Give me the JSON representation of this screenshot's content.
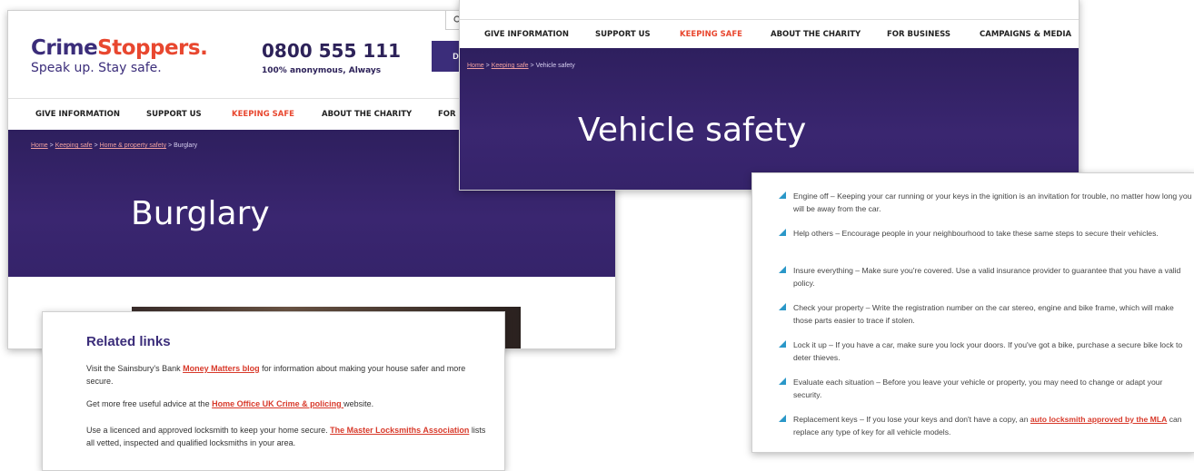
{
  "burglary_page": {
    "logo": {
      "name_a": "Crime",
      "name_b": "Stoppers.",
      "tagline": "Speak up. Stay safe."
    },
    "phone": {
      "number": "0800 555 111",
      "subtitle": "100% anonymous, Always"
    },
    "donate_label": "DO",
    "nav": [
      "GIVE INFORMATION",
      "SUPPORT US",
      "KEEPING SAFE",
      "ABOUT THE CHARITY",
      "FOR B"
    ],
    "breadcrumb": [
      "Home",
      "Keeping safe",
      "Home & property safety",
      "Burglary"
    ],
    "title": "Burglary"
  },
  "related_links": {
    "title": "Related links",
    "p1": {
      "pre": "Visit the Sainsbury's Bank ",
      "link": "Money Matters blog",
      "post": " for information about making your house safer and more secure."
    },
    "p2": {
      "pre": "Get more free useful advice at the ",
      "link": "Home Office UK Crime & policing ",
      "post": "website."
    },
    "p3": {
      "pre": "Use a licenced and approved locksmith to keep your home secure. ",
      "link": "The Master Locksmiths Association",
      "post": " lists all vetted, inspected and qualified locksmiths in your area."
    }
  },
  "vehicle_page": {
    "nav": [
      "GIVE INFORMATION",
      "SUPPORT US",
      "KEEPING SAFE",
      "ABOUT THE CHARITY",
      "FOR BUSINESS",
      "CAMPAIGNS & MEDIA"
    ],
    "breadcrumb": [
      "Home",
      "Keeping safe",
      "Vehicle safety"
    ],
    "title": "Vehicle safety"
  },
  "tips": [
    {
      "text": "Engine off – Keeping your car running or your keys in the ignition is an invitation for trouble, no matter how long you will be away from the car."
    },
    {
      "text": "Help others – Encourage people in your neighbourhood to take these same steps to secure their vehicles."
    },
    {
      "text": "Insure everything – Make sure you're covered. Use a valid insurance provider to guarantee that you have a valid policy."
    },
    {
      "text": "Check your property – Write the registration number on the car stereo, engine and bike frame, which will make those parts easier to trace if stolen."
    },
    {
      "text": "Lock it up – If you have a car, make sure you lock your doors. If you've got a bike, purchase a secure bike lock to deter thieves."
    },
    {
      "text": "Evaluate each situation – Before you leave your vehicle or property, you may need to change or adapt your security."
    },
    {
      "pre": "Replacement keys – If you lose your keys and don't have a copy, an ",
      "link": "auto locksmith approved by the MLA",
      "post": " can replace any type of key for all vehicle models."
    }
  ],
  "colors": {
    "brand_purple": "#3b2d7a",
    "accent_red": "#e8472f",
    "bullet_blue": "#2a97c8"
  }
}
